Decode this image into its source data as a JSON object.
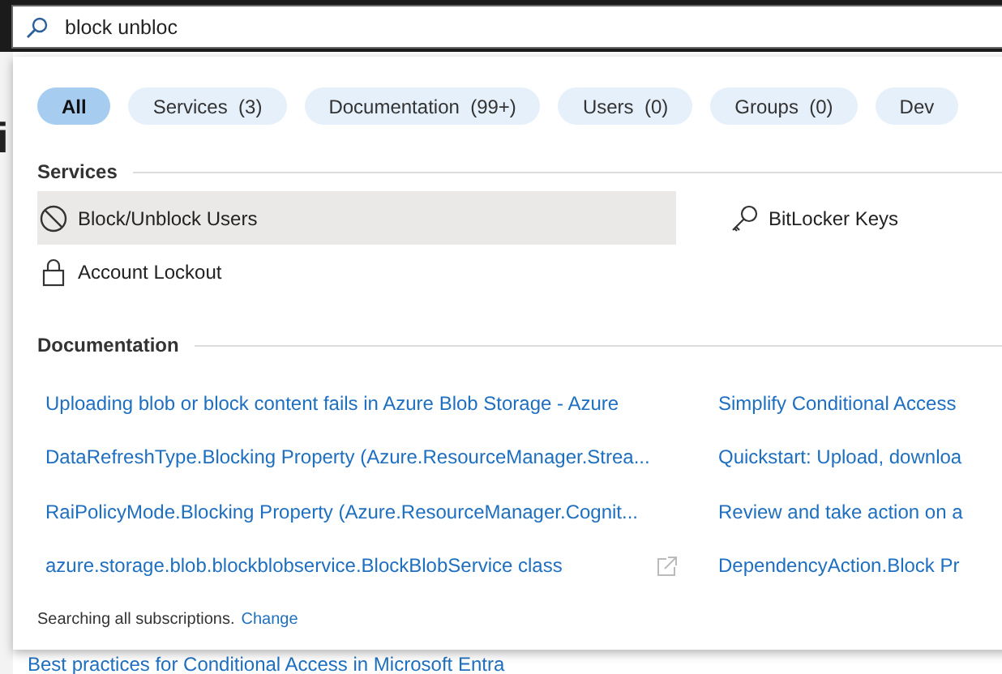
{
  "search": {
    "value": "block unbloc"
  },
  "background": {
    "heading": "i",
    "link": "Best practices for Conditional Access in Microsoft Entra"
  },
  "filters": [
    {
      "label": "All",
      "selected": true
    },
    {
      "label": "Services  (3)",
      "selected": false
    },
    {
      "label": "Documentation  (99+)",
      "selected": false
    },
    {
      "label": "Users  (0)",
      "selected": false
    },
    {
      "label": "Groups  (0)",
      "selected": false
    },
    {
      "label": "Dev",
      "selected": false
    }
  ],
  "services": {
    "title": "Services",
    "items": [
      {
        "label": "Block/Unblock Users",
        "selected": true
      },
      {
        "label": "BitLocker Keys",
        "selected": false
      },
      {
        "label": "Account Lockout",
        "selected": false
      }
    ]
  },
  "documentation": {
    "title": "Documentation",
    "items": [
      {
        "label": "Uploading blob or block content fails in Azure Blob Storage - Azure",
        "external": false
      },
      {
        "label": "Simplify Conditional Access"
      },
      {
        "label": "DataRefreshType.Blocking Property (Azure.ResourceManager.Strea...",
        "external": false
      },
      {
        "label": "Quickstart: Upload, downloa"
      },
      {
        "label": "RaiPolicyMode.Blocking Property (Azure.ResourceManager.Cognit...",
        "external": false
      },
      {
        "label": "Review and take action on a"
      },
      {
        "label": "azure.storage.blob.blockblobservice.BlockBlobService class",
        "external": true
      },
      {
        "label": "DependencyAction.Block Pr"
      }
    ]
  },
  "footer": {
    "text": "Searching all subscriptions.",
    "link": "Change"
  }
}
